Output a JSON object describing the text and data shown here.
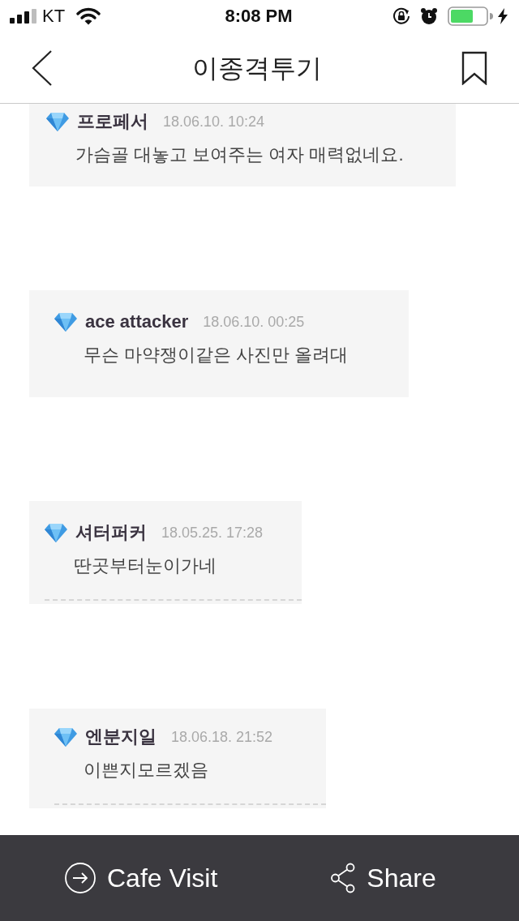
{
  "status_bar": {
    "carrier": "KT",
    "time": "8:08 PM"
  },
  "nav_bar": {
    "title": "이종격투기"
  },
  "comments": [
    {
      "author": "프로페서",
      "date": "18.06.10. 10:24",
      "text": "가슴골 대놓고 보여주는 여자 매력없네요.",
      "separator": false
    },
    {
      "author": "ace attacker",
      "date": "18.06.10. 00:25",
      "text": "무슨 마약쟁이같은 사진만 올려대",
      "separator": false
    },
    {
      "author": "셔터퍼커",
      "date": "18.05.25. 17:28",
      "text": "딴곳부터눈이가네",
      "separator": true
    },
    {
      "author": "엔분지일",
      "date": "18.06.18. 21:52",
      "text": "이쁜지모르겠음",
      "separator": true
    }
  ],
  "bottom_bar": {
    "actions": [
      {
        "kind": "visit",
        "label": "Cafe Visit"
      },
      {
        "kind": "share",
        "label": "Share"
      }
    ]
  }
}
